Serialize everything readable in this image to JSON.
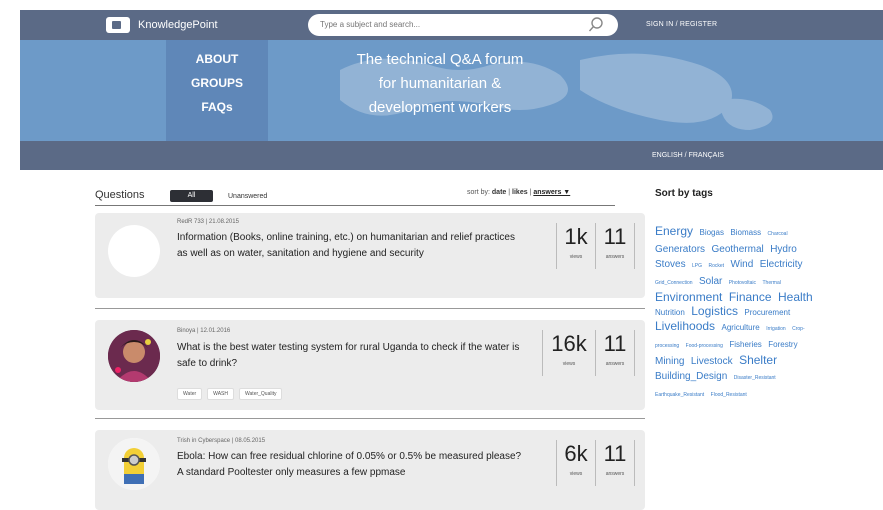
{
  "header": {
    "logo_text": "KnowledgePoint",
    "search_placeholder": "Type a subject and search...",
    "signin": "SIGN IN / REGISTER"
  },
  "hero": {
    "nav": [
      "ABOUT",
      "GROUPS",
      "FAQs"
    ],
    "tagline_lines": [
      "The technical Q&A forum",
      "for humanitarian &",
      "development workers"
    ],
    "language": "ENGLISH / FRANÇAIS"
  },
  "questions": {
    "title": "Questions",
    "tab_all": "All",
    "tab_unanswered": "Unanswered",
    "sort_prefix": "sort by:",
    "sort_date": "date",
    "sort_likes": "likes",
    "sort_answers": "answers ▼",
    "items": [
      {
        "meta": "RedR 733 | 21.08.2015",
        "title": "Information (Books, online training, etc.) on humanitarian and relief practices as well as on water, sanitation and hygiene and security",
        "views": "1k",
        "answers": "11",
        "views_label": "views",
        "answers_label": "answers",
        "tags": []
      },
      {
        "meta": "Binoya | 12.01.2016",
        "title": "What is the best water testing system for rural Uganda to check if the water is safe to drink?",
        "views": "16k",
        "answers": "11",
        "views_label": "views",
        "answers_label": "answers",
        "tags": [
          "Water",
          "WASH",
          "Water_Quality"
        ]
      },
      {
        "meta": "Trish in Cyberspace | 08.05.2015",
        "title": "Ebola: How can free residual chlorine of 0.05% or 0.5% be measured please? A standard Pooltester only measures a few ppmase",
        "views": "6k",
        "answers": "11",
        "views_label": "views",
        "answers_label": "answers",
        "tags": []
      }
    ]
  },
  "sidebar": {
    "title": "Sort by tags",
    "tags": [
      {
        "label": "Energy",
        "size": "xl"
      },
      {
        "label": "Biogas",
        "size": "m"
      },
      {
        "label": "Biomass",
        "size": "m"
      },
      {
        "label": "Charcoal",
        "size": "s"
      },
      {
        "label": "Generators",
        "size": "l"
      },
      {
        "label": "Geothermal",
        "size": "l"
      },
      {
        "label": "Hydro",
        "size": "l"
      },
      {
        "label": "Stoves",
        "size": "l"
      },
      {
        "label": "LPG",
        "size": "s"
      },
      {
        "label": "Rocket",
        "size": "s"
      },
      {
        "label": "Wind",
        "size": "l"
      },
      {
        "label": "Electricity",
        "size": "l"
      },
      {
        "label": "Grid_Connection",
        "size": "s"
      },
      {
        "label": "Solar",
        "size": "l"
      },
      {
        "label": "Photovoltaic",
        "size": "s"
      },
      {
        "label": "Thermal",
        "size": "s"
      },
      {
        "label": "Environment",
        "size": "xl"
      },
      {
        "label": "Finance",
        "size": "xl"
      },
      {
        "label": "Health",
        "size": "xl"
      },
      {
        "label": "Nutrition",
        "size": "m"
      },
      {
        "label": "Logistics",
        "size": "xl"
      },
      {
        "label": "Procurement",
        "size": "m"
      },
      {
        "label": "Livelihoods",
        "size": "xl"
      },
      {
        "label": "Agriculture",
        "size": "m"
      },
      {
        "label": "Irrigation",
        "size": "s"
      },
      {
        "label": "Crop-processing",
        "size": "s"
      },
      {
        "label": "Food-processing",
        "size": "s"
      },
      {
        "label": "Fisheries",
        "size": "m"
      },
      {
        "label": "Forestry",
        "size": "m"
      },
      {
        "label": "Mining",
        "size": "l"
      },
      {
        "label": "Livestock",
        "size": "l"
      },
      {
        "label": "Shelter",
        "size": "xl"
      },
      {
        "label": "Building_Design",
        "size": "l"
      },
      {
        "label": "Disaster_Resistant",
        "size": "s"
      },
      {
        "label": "Earthquake_Resistant",
        "size": "s"
      },
      {
        "label": "Flood_Resistant",
        "size": "s"
      }
    ]
  }
}
